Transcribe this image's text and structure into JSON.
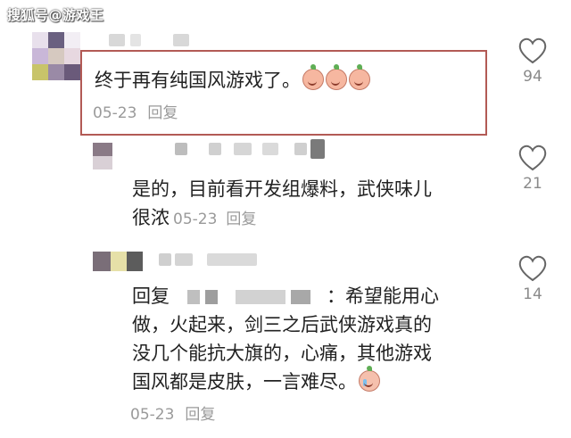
{
  "watermark": "搜狐号@游戏王",
  "comments": [
    {
      "text_line1": "终于再有纯国风游戏了。",
      "date": "05-23",
      "reply_label": "回复",
      "likes": "94",
      "emoji_count": 3
    },
    {
      "text_line1": "是的，目前看开发组爆料，武侠味儿",
      "text_line2": "很浓",
      "date": "05-23",
      "reply_label": "回复",
      "likes": "21"
    },
    {
      "reply_prefix": "回复",
      "reply_colon": "：",
      "text_line1": "希望能用心",
      "text_line2": "做，火起来，剑三之后武侠游戏真的",
      "text_line3": "没几个能抗大旗的，心痛，其他游戏",
      "text_line4": "国风都是皮肤，一言难尽。",
      "date": "05-23",
      "reply_label": "回复",
      "likes": "14"
    }
  ],
  "colors": {
    "highlight_border": "#b25a55",
    "meta_text": "#9a9a9a",
    "body_text": "#222222"
  }
}
